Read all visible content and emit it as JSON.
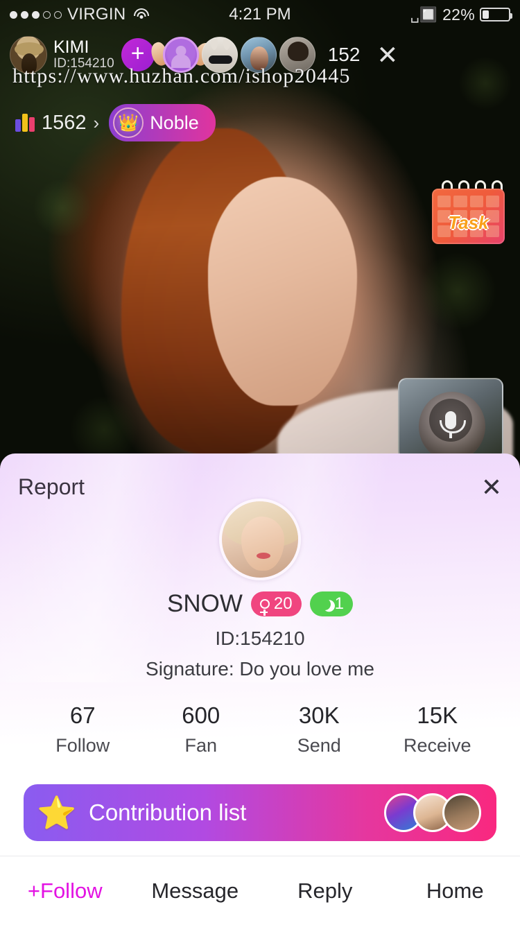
{
  "status_bar": {
    "signal_dots_filled": 3,
    "signal_dots_total": 5,
    "carrier": "VIRGIN",
    "wifi_icon": "wifi-icon",
    "time": "4:21 PM",
    "bluetooth_icon": "bluetooth-icon",
    "battery_percent": "22%",
    "battery_level": 22
  },
  "live": {
    "host": {
      "name": "KIMI",
      "id": "ID:154210",
      "avatar_icon": "host-avatar"
    },
    "add_button": "+",
    "viewers": [
      {
        "name": "viewer-avatar-framed"
      },
      {
        "name": "viewer-avatar-bunny"
      },
      {
        "name": "viewer-avatar-girl"
      },
      {
        "name": "viewer-avatar-boy"
      }
    ],
    "viewer_count": "152",
    "close_icon": "close-icon",
    "watermark": "https://www.huzhan.com/ishop20445",
    "rank": {
      "icon": "bar-chart-icon",
      "value": "1562",
      "chevron": "›"
    },
    "noble": {
      "icon": "👑",
      "label": "Noble"
    },
    "task": {
      "label": "Task",
      "icon": "task-calendar-icon"
    },
    "pip": {
      "mic_icon": "microphone-icon"
    }
  },
  "sheet": {
    "report_label": "Report",
    "close_icon": "✕",
    "profile": {
      "avatar_icon": "profile-avatar",
      "nickname": "SNOW",
      "gender_badge": {
        "icon": "female-icon",
        "value": "20"
      },
      "level_badge": {
        "icon": "moon-icon",
        "value": "1"
      },
      "id": "ID:154210",
      "signature": "Signature: Do you love me"
    },
    "stats": [
      {
        "value": "67",
        "label": "Follow"
      },
      {
        "value": "600",
        "label": "Fan"
      },
      {
        "value": "30K",
        "label": "Send"
      },
      {
        "value": "15K",
        "label": "Receive"
      }
    ],
    "contribution": {
      "icon": "⭐",
      "label": "Contribution list",
      "avatars": [
        "contributor-avatar-1",
        "contributor-avatar-2",
        "contributor-avatar-3"
      ]
    },
    "actions": [
      {
        "label": "+Follow",
        "name": "follow-button"
      },
      {
        "label": "Message",
        "name": "message-button"
      },
      {
        "label": "Reply",
        "name": "reply-button"
      },
      {
        "label": "Home",
        "name": "home-button"
      }
    ]
  },
  "colors": {
    "follow_accent": "#e312e3",
    "gender_badge": "#f0457f",
    "level_badge": "#52d14e",
    "contrib_start": "#8a5cf0",
    "contrib_end": "#f9287f"
  }
}
